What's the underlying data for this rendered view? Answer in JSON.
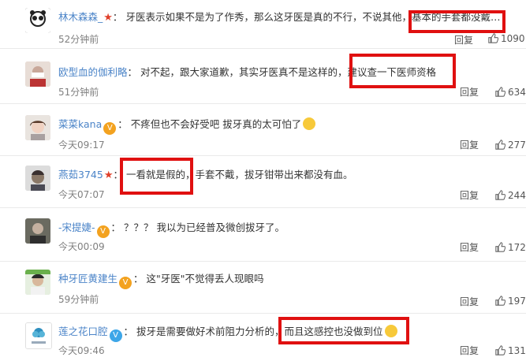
{
  "comments": [
    {
      "username": "林木森森_",
      "text_before": "牙医表示如果不是为了作秀，那么这牙医是真的不行，不说其他，",
      "text_highlight": "基本的手套都没戴",
      "text_after": "…",
      "time": "52分钟前",
      "reply": "回复",
      "likes": "1090",
      "has_star": true
    },
    {
      "username": "欧型血的伽利略",
      "text_before": "对不起，跟大家道歉，其实牙医真不是这样的，",
      "text_highlight": "建议查一下医师资格",
      "text_after": "",
      "time": "51分钟前",
      "reply": "回复",
      "likes": "634"
    },
    {
      "username": "菜菜kana",
      "text_before": "不疼但也不会好受吧 拔牙真的太可怕了",
      "text_highlight": "",
      "text_after": "",
      "time": "今天09:17",
      "reply": "回复",
      "likes": "277",
      "badge": "V"
    },
    {
      "username": "燕茹3745",
      "text_before": "",
      "text_highlight": "一看就是假的",
      "text_after": "，手套不戴，拔牙钳带出来都没有血。",
      "time": "今天07:07",
      "reply": "回复",
      "likes": "244",
      "has_star": true
    },
    {
      "username": "-宋提婕-",
      "text_before": "？？？ 我以为已经普及微创拔牙了。",
      "text_highlight": "",
      "text_after": "",
      "time": "今天00:09",
      "reply": "回复",
      "likes": "172",
      "badge": "V"
    },
    {
      "username": "种牙匠黄建生",
      "text_before": "这\"牙医\"不觉得丢人现眼吗",
      "text_highlight": "",
      "text_after": "",
      "time": "59分钟前",
      "reply": "回复",
      "likes": "197",
      "badge": "V"
    },
    {
      "username": "莲之花口腔",
      "text_before": "拔牙是需要做好术前阻力分析的，",
      "text_highlight": "而且这感控也没做到位",
      "text_after": "",
      "time": "今天09:46",
      "reply": "回复",
      "likes": "131",
      "badge": "V"
    }
  ],
  "colors": {
    "username": "#4b84c8",
    "highlight_box": "#e01010",
    "badge_gold": "#f3a21f",
    "badge_blue": "#3da6e8"
  }
}
